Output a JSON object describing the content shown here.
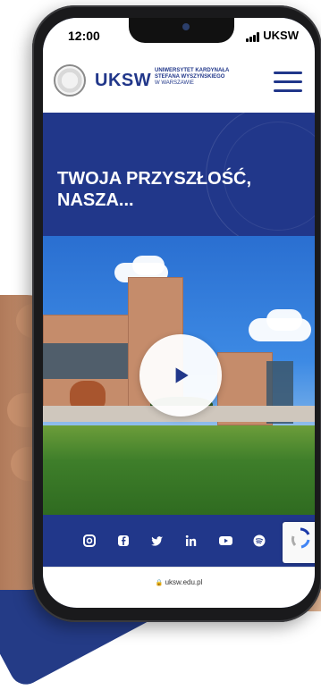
{
  "status": {
    "time": "12:00",
    "carrier": "UKSW"
  },
  "header": {
    "brand": "UKSW",
    "university": [
      "UNIWERSYTET KARDYNAŁA",
      "STEFANA WYSZYŃSKIEGO",
      "W WARSZAWIE"
    ]
  },
  "hero": {
    "headline_line1": "TWOJA PRZYSZŁOŚĆ,",
    "headline_line2": "NASZA..."
  },
  "social": {
    "icons": [
      "instagram-icon",
      "facebook-icon",
      "twitter-icon",
      "linkedin-icon",
      "youtube-icon",
      "spotify-icon",
      "tiktok-icon"
    ]
  },
  "browser": {
    "url": "uksw.edu.pl"
  },
  "colors": {
    "primary": "#21378a",
    "white": "#ffffff"
  }
}
